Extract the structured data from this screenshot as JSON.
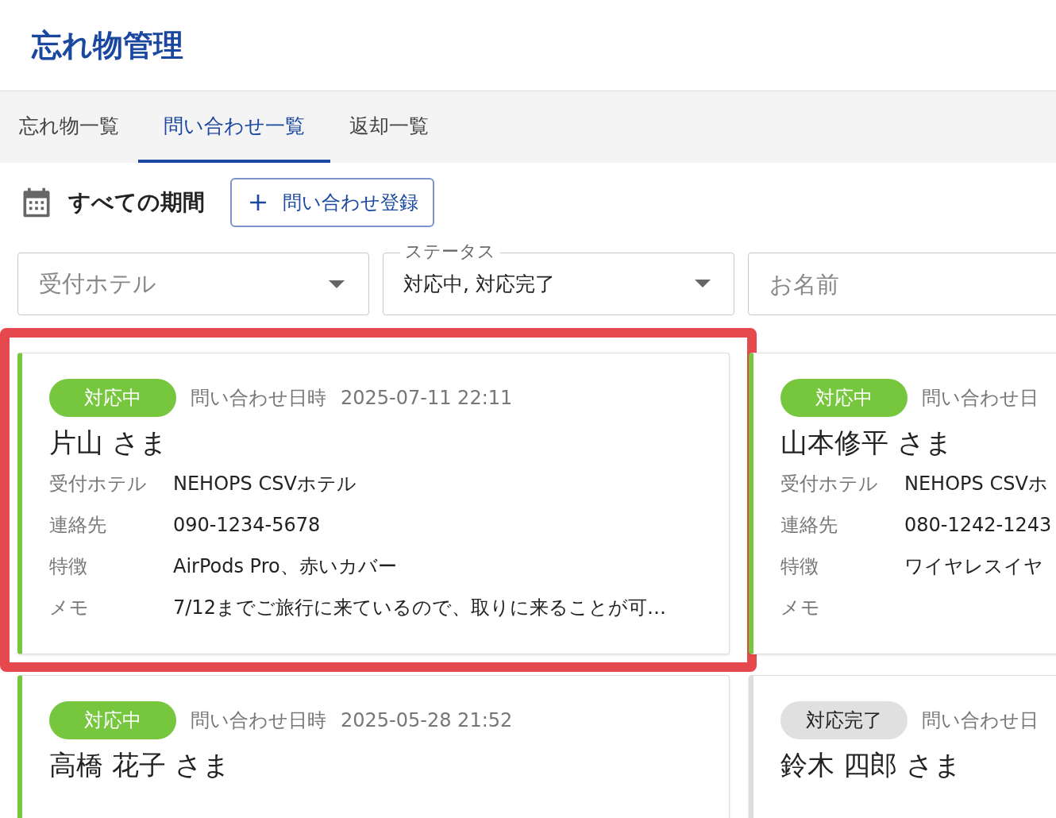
{
  "app_title": "忘れ物管理",
  "tabs": [
    {
      "label": "忘れ物一覧",
      "selected": false
    },
    {
      "label": "問い合わせ一覧",
      "selected": true
    },
    {
      "label": "返却一覧",
      "selected": false
    }
  ],
  "period": {
    "label": "すべての期間"
  },
  "add_button": {
    "label": "問い合わせ登録"
  },
  "filters": [
    {
      "kind": "select",
      "placeholder": "受付ホテル"
    },
    {
      "kind": "select",
      "label": "ステータス",
      "value": "対応中, 対応完了"
    },
    {
      "kind": "text",
      "placeholder": "お名前"
    }
  ],
  "cards": [
    {
      "status": {
        "label": "対応中",
        "kind": "active"
      },
      "date_label": "問い合わせ日時",
      "date": "2025-07-11 22:11",
      "name": "片山 さま",
      "highlighted": true,
      "fields": [
        {
          "label": "受付ホテル",
          "value": "NEHOPS CSVホテル"
        },
        {
          "label": "連絡先",
          "value": "090-1234-5678"
        },
        {
          "label": "特徴",
          "value": "AirPods Pro、赤いカバー"
        },
        {
          "label": "メモ",
          "value": "7/12までご旅行に来ているので、取りに来ることが可…"
        }
      ]
    },
    {
      "status": {
        "label": "対応中",
        "kind": "active"
      },
      "date_label": "問い合わせ日",
      "name": "山本修平 さま",
      "highlighted": false,
      "fields": [
        {
          "label": "受付ホテル",
          "value": "NEHOPS CSVホ"
        },
        {
          "label": "連絡先",
          "value": "080-1242-1243"
        },
        {
          "label": "特徴",
          "value": "ワイヤレスイヤ"
        },
        {
          "label": "メモ"
        }
      ]
    },
    {
      "status": {
        "label": "対応中",
        "kind": "active"
      },
      "date_label": "問い合わせ日時",
      "date": "2025-05-28 21:52",
      "name": "高橋 花子 さま",
      "highlighted": false
    },
    {
      "status": {
        "label": "対応完了",
        "kind": "done"
      },
      "date_label": "問い合わせ日",
      "name": "鈴木 四郎 さま",
      "highlighted": false
    }
  ]
}
